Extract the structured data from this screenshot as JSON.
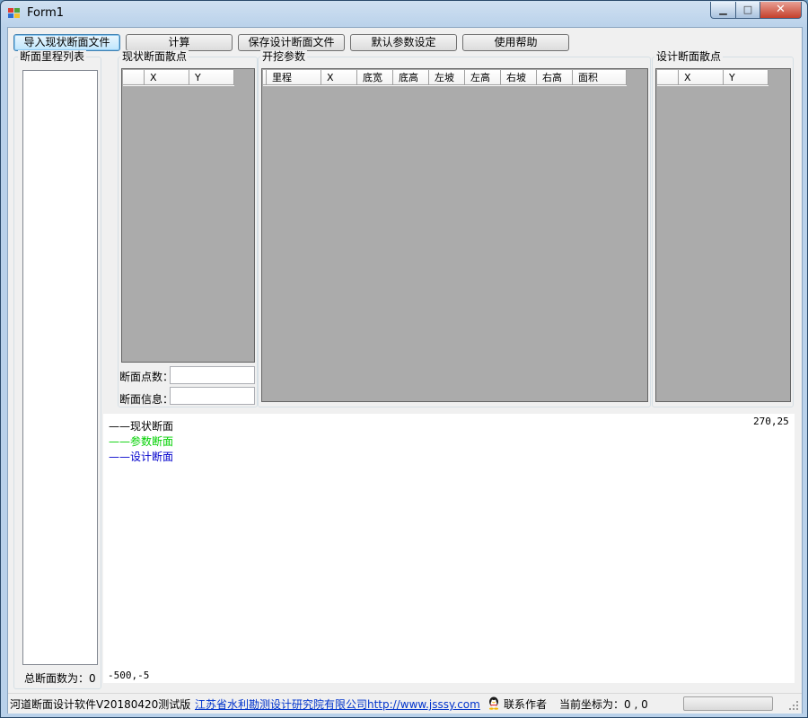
{
  "window": {
    "title": "Form1"
  },
  "toolbar": {
    "import_label": "导入现状断面文件",
    "calc_label": "计算",
    "save_label": "保存设计断面文件",
    "default_params_label": "默认参数设定",
    "help_label": "使用帮助"
  },
  "mileage_list": {
    "label": "断面里程列表",
    "total_label": "总断面数为：0"
  },
  "current_points": {
    "label": "现状断面散点",
    "columns": [
      "X",
      "Y"
    ],
    "point_count_label": "断面点数：",
    "info_label": "断面信息："
  },
  "excavation": {
    "label": "开挖参数",
    "columns": [
      "里程",
      "X",
      "底宽",
      "底高",
      "左坡",
      "左高",
      "右坡",
      "右高",
      "面积"
    ]
  },
  "design_points": {
    "label": "设计断面散点",
    "columns": [
      "X",
      "Y"
    ]
  },
  "chart": {
    "legend": [
      {
        "label": "——现状断面",
        "color": "#000000"
      },
      {
        "label": "——参数断面",
        "color": "#00d000"
      },
      {
        "label": "——设计断面",
        "color": "#0000cc"
      }
    ],
    "top_right_coord": "270,25",
    "bottom_left_coord": "-500,-5"
  },
  "status": {
    "software": "河道断面设计软件V20180420测试版",
    "company_link": "江苏省水利勘测设计研究院有限公司http://www.jsssy.com",
    "contact": "联系作者",
    "coords": "当前坐标为：0 , 0",
    "progress": 0
  }
}
